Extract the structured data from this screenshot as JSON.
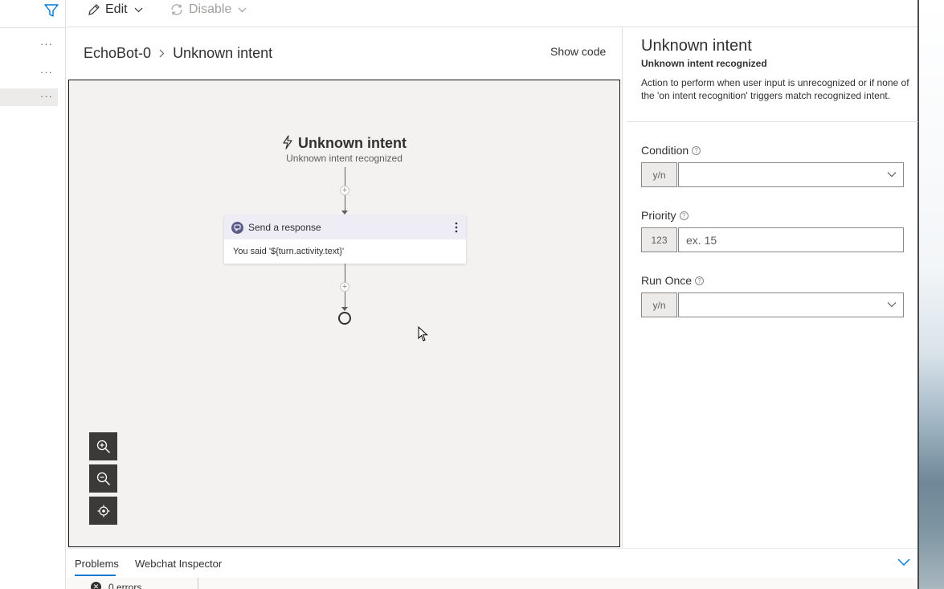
{
  "toolbar": {
    "edit_label": "Edit",
    "disable_label": "Disable"
  },
  "breadcrumb": {
    "root": "EchoBot-0",
    "current": "Unknown intent"
  },
  "show_code_label": "Show code",
  "canvas": {
    "trigger_title": "Unknown intent",
    "trigger_subtitle": "Unknown intent recognized",
    "action_title": "Send a response",
    "action_body": "You said '${turn.activity.text}'"
  },
  "pane": {
    "title": "Unknown intent",
    "subtitle": "Unknown intent recognized",
    "description": "Action to perform when user input is unrecognized or if none of the 'on intent recognition' triggers match recognized intent.",
    "fields": {
      "condition": {
        "label": "Condition",
        "type": "y/n",
        "value": ""
      },
      "priority": {
        "label": "Priority",
        "type": "123",
        "placeholder": "ex. 15"
      },
      "run_once": {
        "label": "Run Once",
        "type": "y/n",
        "value": ""
      }
    }
  },
  "bottom": {
    "tabs": [
      "Problems",
      "Webchat Inspector"
    ],
    "errors_text": "0 errors"
  },
  "colors": {
    "accent": "#0078d4",
    "canvas_bg": "#f3f2f1",
    "card_header": "#eeecf5"
  }
}
